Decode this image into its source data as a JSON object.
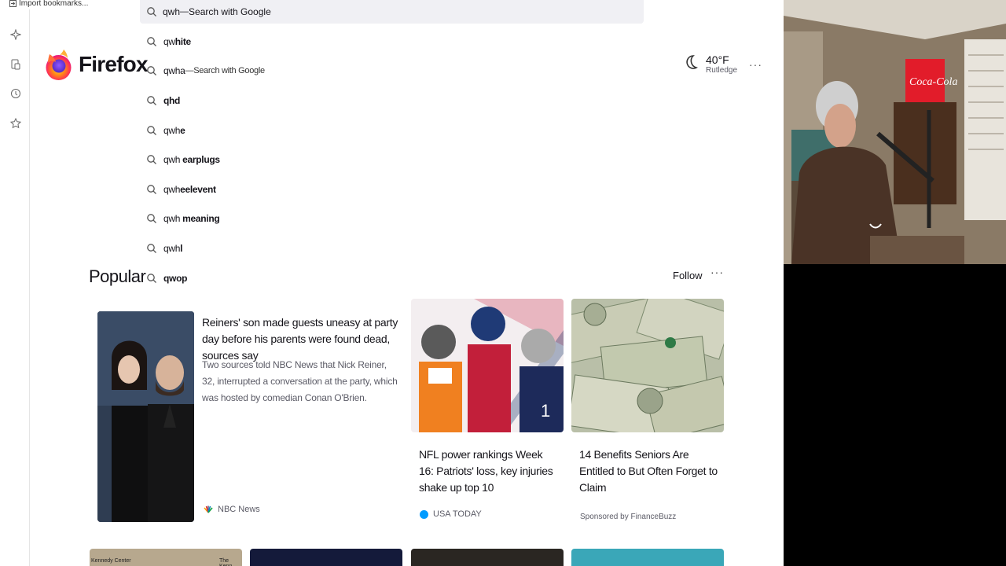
{
  "bookmarks": {
    "import_label": "Import bookmarks..."
  },
  "urlbar": {
    "query": "qwh",
    "separator": " — ",
    "engine_label": "Search with Google"
  },
  "suggestions": [
    {
      "prefix": "qw",
      "bold": "hite",
      "engine": ""
    },
    {
      "prefix": "qwha",
      "bold": "",
      "engine": "Search with Google"
    },
    {
      "prefix": "",
      "bold": "qhd",
      "engine": ""
    },
    {
      "prefix": "qwh",
      "bold": "e",
      "engine": ""
    },
    {
      "prefix": "qwh ",
      "bold": "earplugs",
      "engine": ""
    },
    {
      "prefix": "qwh",
      "bold": "eelevent",
      "engine": ""
    },
    {
      "prefix": "qwh ",
      "bold": "meaning",
      "engine": ""
    },
    {
      "prefix": "qwh",
      "bold": "l",
      "engine": ""
    },
    {
      "prefix": "",
      "bold": "qwop",
      "engine": ""
    }
  ],
  "logo": {
    "text": "Firefox"
  },
  "weather": {
    "temp": "40°F",
    "city": "Rutledge",
    "more": "···"
  },
  "section": {
    "title": "Popular",
    "follow": "Follow",
    "more": "···"
  },
  "cards": {
    "main": {
      "title": "Reiners' son made guests uneasy at party day before his parents were found dead, sources say",
      "excerpt": "Two sources told NBC News that Nick Reiner, 32, interrupted a conversation at the party, which was hosted by comedian Conan O'Brien.",
      "source": "NBC News"
    },
    "nfl": {
      "title": "NFL power rankings Week 16: Patriots' loss, key injuries shake up top 10",
      "source": "USA TODAY"
    },
    "money": {
      "title": "14 Benefits Seniors Are Entitled to But Often Forget to Claim",
      "source": "Sponsored by FinanceBuzz"
    }
  },
  "bottom_thumbs": [
    {
      "caption_left": "Kennedy Center",
      "caption_right": "The Kenn"
    },
    {
      "caption_left": "",
      "caption_right": ""
    },
    {
      "caption_left": "",
      "caption_right": ""
    },
    {
      "caption_left": "",
      "caption_right": ""
    }
  ],
  "colors": {
    "accent": "#0060df",
    "muted": "#5b5b66",
    "urlbar_bg": "#f0f0f4"
  }
}
